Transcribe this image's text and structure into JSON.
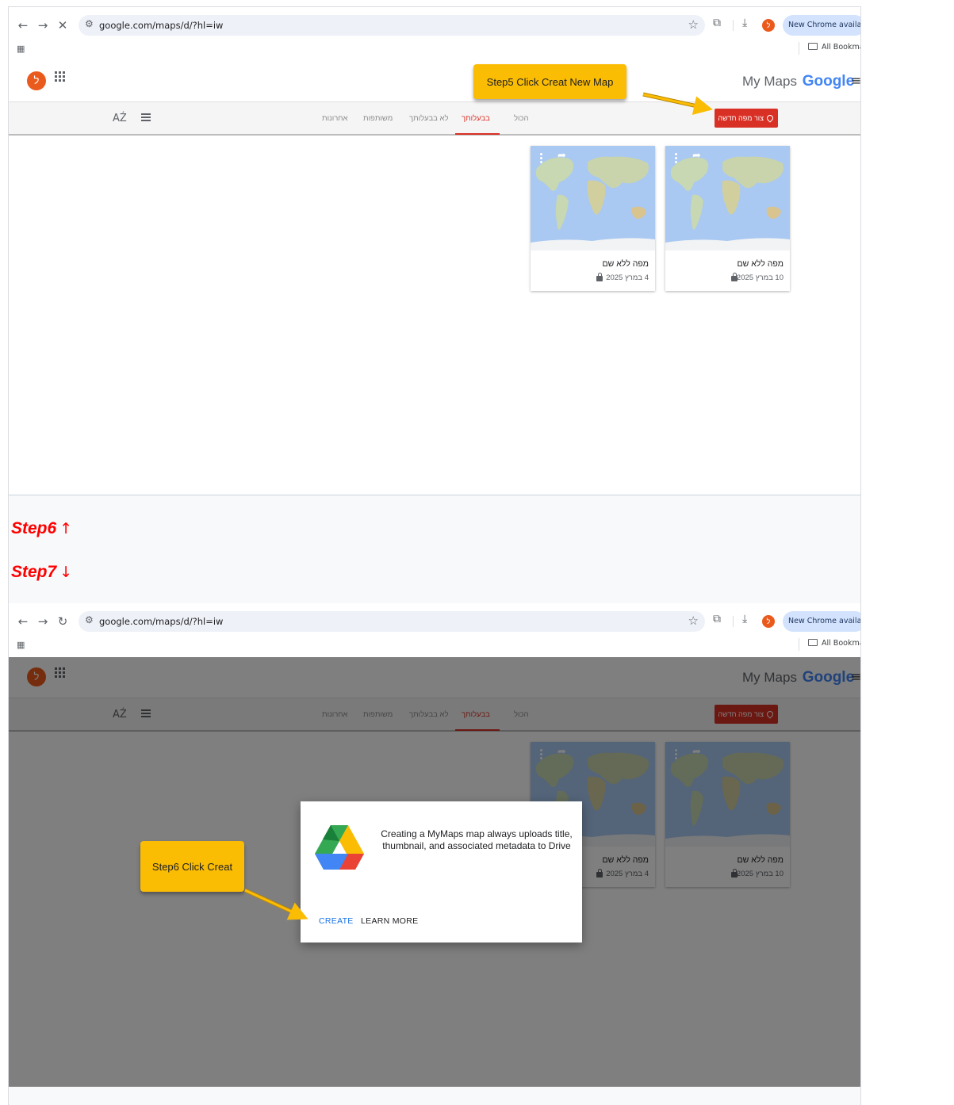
{
  "browser": {
    "url": "google.com/maps/d/?hl=iw",
    "new_chrome_label": "New Chrome available",
    "bookmarks_label": "All Bookmar",
    "profile_letter": "ל"
  },
  "header": {
    "brand_prefix": "My Maps",
    "brand_google": "Google",
    "avatar_letter": "ל"
  },
  "tabs": [
    {
      "label": "הכול"
    },
    {
      "label": "בבעלותך",
      "active": true
    },
    {
      "label": "לא בבעלותך"
    },
    {
      "label": "משותפות"
    },
    {
      "label": "אחרונות"
    }
  ],
  "create_button_label": "צור מפה חדשה",
  "sort_label": "AŹ",
  "cards": [
    {
      "title": "מפה ללא שם",
      "date": "10 במרץ 2025"
    },
    {
      "title": "מפה ללא שם",
      "date": "4 במרץ 2025"
    }
  ],
  "annotations": {
    "step5_callout": "Step5 Click Creat New Map",
    "step6_text": "Step6",
    "step6_arrow": "↑",
    "step7_text": "Step7",
    "step7_arrow": "↓",
    "step6_callout": "Step6 Click Creat"
  },
  "dialog": {
    "message": "Creating a MyMaps map always uploads title, thumbnail, and associated metadata to Drive",
    "create_label": "CREATE",
    "learn_more_label": "LEARN MORE"
  },
  "colors": {
    "accent_red": "#d93025",
    "callout_yellow": "#fbbc04",
    "step_text_red": "#ff0000",
    "link_blue": "#1a73e8"
  }
}
